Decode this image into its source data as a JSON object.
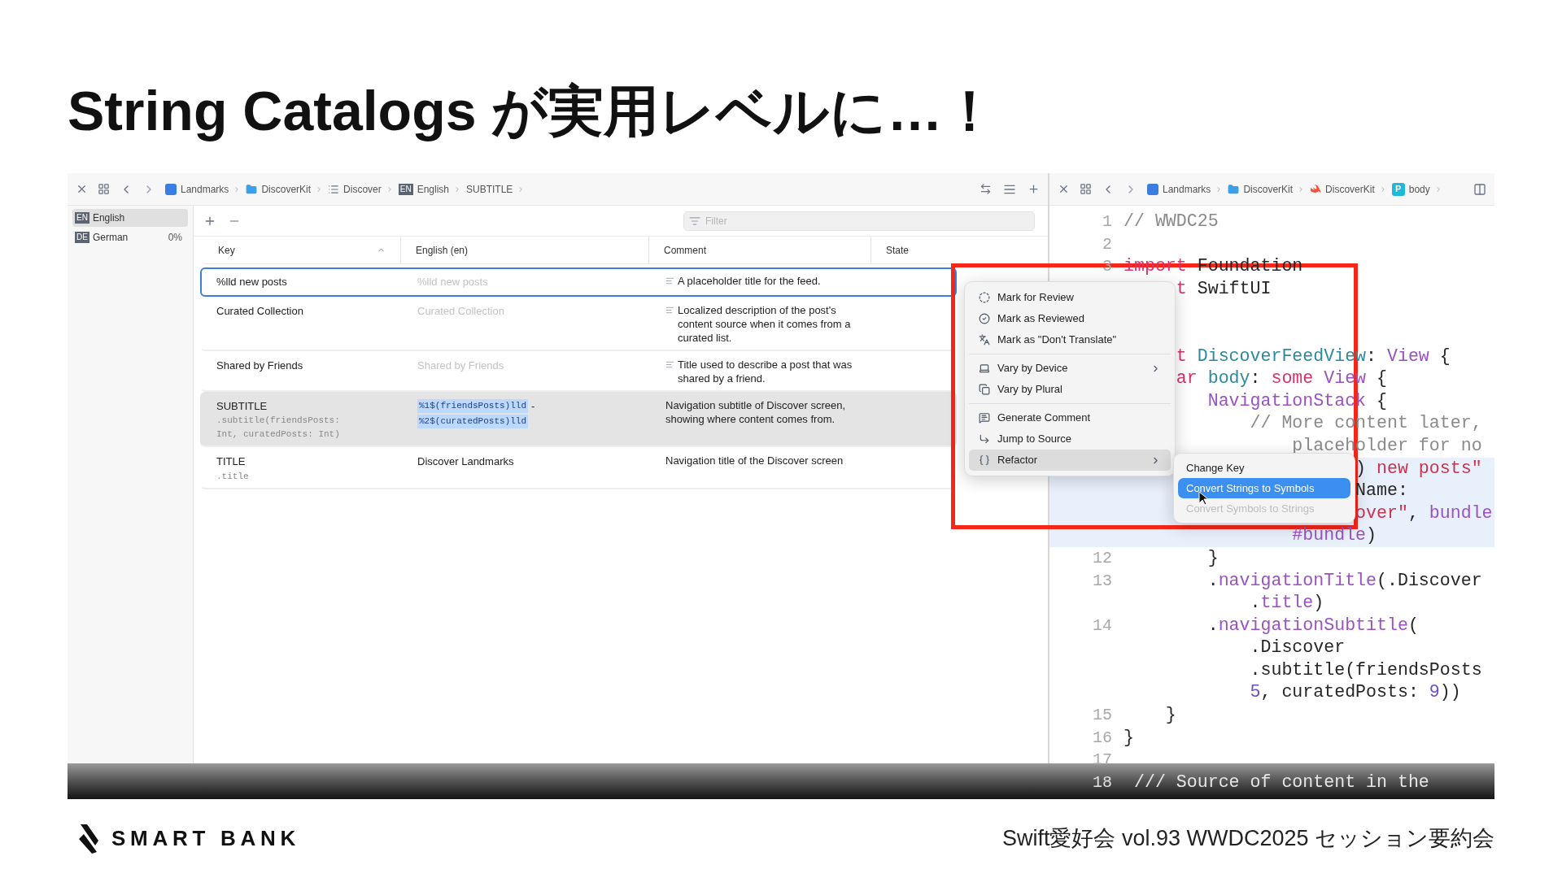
{
  "slide": {
    "title": "String Catalogs が実用レベルに…！"
  },
  "catalog": {
    "breadcrumbs": [
      {
        "kind": "app",
        "label": "Landmarks"
      },
      {
        "kind": "folder",
        "label": "DiscoverKit"
      },
      {
        "kind": "list",
        "label": "Discover"
      },
      {
        "kind": "language",
        "badge": "EN",
        "label": "English"
      },
      {
        "kind": "plain",
        "label": "SUBTITLE"
      }
    ],
    "languages": [
      {
        "badge": "EN",
        "name": "English",
        "selected": true
      },
      {
        "badge": "DE",
        "name": "German",
        "progress": "0%",
        "selected": false
      }
    ],
    "filter": {
      "placeholder": "Filter"
    },
    "columns": [
      {
        "label": "Key",
        "sorted": true
      },
      {
        "label": "English (en)",
        "sorted": false
      },
      {
        "label": "Comment",
        "sorted": false
      },
      {
        "label": "State",
        "sorted": false
      }
    ],
    "rows": [
      {
        "key": "%lld new posts",
        "english": [
          [
            {
              "kind": "faded",
              "text": "%lld new posts"
            }
          ]
        ],
        "comment": "A placeholder title for the feed.",
        "generated": true,
        "focused": true,
        "selected": false
      },
      {
        "key": "Curated Collection",
        "english": [
          [
            {
              "kind": "faded",
              "text": "Curated Collection"
            }
          ]
        ],
        "comment": "Localized description of the post's content source when it comes from a curated list.",
        "generated": true,
        "focused": false,
        "selected": false
      },
      {
        "key": "Shared by Friends",
        "english": [
          [
            {
              "kind": "faded",
              "text": "Shared by Friends"
            }
          ]
        ],
        "comment": "Title used to describe a post that was shared by a friend.",
        "generated": true,
        "focused": false,
        "selected": false
      },
      {
        "key": "SUBTITLE",
        "symbol": ".subtitle(friendsPosts: Int, curatedPosts: Int)",
        "english": [
          [
            {
              "kind": "token",
              "text": "%1$(friendsPosts)lld"
            },
            {
              "kind": "plain",
              "text": "-"
            }
          ],
          [
            {
              "kind": "token",
              "text": "%2$(curatedPosts)lld"
            }
          ]
        ],
        "comment": "Navigation subtitle of Discover screen, showing where content comes from.",
        "generated": false,
        "focused": false,
        "selected": true
      },
      {
        "key": "TITLE",
        "symbol": ".title",
        "english": [
          [
            {
              "kind": "plain",
              "text": "Discover Landmarks"
            }
          ]
        ],
        "comment": "Navigation title of the Discover screen",
        "generated": false,
        "focused": false,
        "selected": false
      }
    ]
  },
  "editor": {
    "breadcrumbs": [
      {
        "kind": "app",
        "label": "Landmarks"
      },
      {
        "kind": "folder",
        "label": "DiscoverKit"
      },
      {
        "kind": "swift",
        "label": "DiscoverKit"
      },
      {
        "kind": "property",
        "badge": "P",
        "label": "body"
      }
    ],
    "lines": [
      {
        "number": "1",
        "highlighted": false,
        "segments": [
          {
            "kind": "comment",
            "text": "// WWDC25"
          }
        ]
      },
      {
        "number": "2",
        "highlighted": false
      },
      {
        "number": "3",
        "highlighted": false,
        "segments": [
          {
            "kind": "keyword",
            "text": "import"
          },
          {
            "kind": "plain",
            "text": " Foundation"
          }
        ]
      },
      {
        "highlighted": false,
        "segments": [
          {
            "kind": "keyword",
            "text": "     t"
          },
          {
            "kind": "plain",
            "text": " SwiftUI"
          }
        ]
      },
      {
        "highlighted": false
      },
      {
        "highlighted": false
      },
      {
        "highlighted": false,
        "segments": [
          {
            "kind": "keyword",
            "text": "     t"
          },
          {
            "kind": "declaration",
            "text": " DiscoverFeedView"
          },
          {
            "kind": "plain",
            "text": ": "
          },
          {
            "kind": "type",
            "text": "View"
          },
          {
            "kind": "plain",
            "text": " {"
          }
        ]
      },
      {
        "highlighted": false,
        "segments": [
          {
            "kind": "keyword",
            "text": "     ar"
          },
          {
            "kind": "declaration",
            "text": " body"
          },
          {
            "kind": "plain",
            "text": ": "
          },
          {
            "kind": "keyword",
            "text": "some"
          },
          {
            "kind": "type",
            "text": " View"
          },
          {
            "kind": "plain",
            "text": " {"
          }
        ]
      },
      {
        "highlighted": false,
        "segments": [
          {
            "kind": "type",
            "text": "        NavigationStack"
          },
          {
            "kind": "plain",
            "text": " {"
          }
        ]
      },
      {
        "highlighted": false,
        "segments": [
          {
            "kind": "comment",
            "text": "            // More content later,"
          }
        ]
      },
      {
        "highlighted": false,
        "segments": [
          {
            "kind": "comment",
            "text": "                placeholder for no"
          }
        ]
      },
      {
        "highlighted": true,
        "segments": [
          {
            "kind": "plain",
            "text": "                      )"
          },
          {
            "kind": "string",
            "text": " new posts\""
          }
        ]
      },
      {
        "highlighted": true,
        "segments": [
          {
            "kind": "plain",
            "text": "                      Name:"
          }
        ]
      },
      {
        "highlighted": true,
        "segments": [
          {
            "kind": "string",
            "text": "                      over\""
          },
          {
            "kind": "plain",
            "text": ", "
          },
          {
            "kind": "type",
            "text": "bundle"
          }
        ]
      },
      {
        "highlighted": true,
        "segments": [
          {
            "kind": "type",
            "text": "                #bundle"
          },
          {
            "kind": "plain",
            "text": ")"
          }
        ]
      },
      {
        "number": "12",
        "highlighted": false,
        "segments": [
          {
            "kind": "plain",
            "text": "        }"
          }
        ]
      },
      {
        "number": "13",
        "highlighted": false,
        "segments": [
          {
            "kind": "plain",
            "text": "        ."
          },
          {
            "kind": "type",
            "text": "navigationTitle"
          },
          {
            "kind": "plain",
            "text": "(.Discover"
          }
        ]
      },
      {
        "highlighted": false,
        "segments": [
          {
            "kind": "plain",
            "text": "            ."
          },
          {
            "kind": "type",
            "text": "title"
          },
          {
            "kind": "plain",
            "text": ")"
          }
        ]
      },
      {
        "number": "14",
        "highlighted": false,
        "segments": [
          {
            "kind": "plain",
            "text": "        ."
          },
          {
            "kind": "type",
            "text": "navigationSubtitle"
          },
          {
            "kind": "plain",
            "text": "("
          }
        ]
      },
      {
        "highlighted": false,
        "segments": [
          {
            "kind": "plain",
            "text": "            .Discover"
          }
        ]
      },
      {
        "highlighted": false,
        "segments": [
          {
            "kind": "plain",
            "text": "            .subtitle(friendsPosts"
          }
        ]
      },
      {
        "highlighted": false,
        "segments": [
          {
            "kind": "number",
            "text": "            5"
          },
          {
            "kind": "plain",
            "text": ", curatedPosts: "
          },
          {
            "kind": "number",
            "text": "9"
          },
          {
            "kind": "plain",
            "text": "))"
          }
        ]
      },
      {
        "number": "15",
        "highlighted": false,
        "segments": [
          {
            "kind": "plain",
            "text": "    }"
          }
        ]
      },
      {
        "number": "16",
        "highlighted": false,
        "segments": [
          {
            "kind": "plain",
            "text": "}"
          }
        ]
      },
      {
        "number": "17",
        "highlighted": false
      },
      {
        "number": "18",
        "segments": [
          {
            "kind": "comment",
            "text": " /// Source of content in the"
          }
        ]
      }
    ]
  },
  "context_menu": {
    "groups": [
      [
        {
          "kind": "review",
          "label": "Mark for Review",
          "submenu": false,
          "selected": false
        },
        {
          "kind": "reviewed",
          "label": "Mark as Reviewed",
          "submenu": false,
          "selected": false
        },
        {
          "kind": "translate",
          "label": "Mark as \"Don't Translate\"",
          "submenu": false,
          "selected": false
        }
      ],
      [
        {
          "kind": "device",
          "label": "Vary by Device",
          "submenu": true,
          "selected": false
        },
        {
          "kind": "plural",
          "label": "Vary by Plural",
          "submenu": false,
          "selected": false
        }
      ],
      [
        {
          "kind": "comment",
          "label": "Generate Comment",
          "submenu": false,
          "selected": false
        },
        {
          "kind": "jump",
          "label": "Jump to Source",
          "submenu": false,
          "selected": false
        },
        {
          "kind": "refactor",
          "label": "Refactor",
          "submenu": true,
          "selected": true
        }
      ]
    ]
  },
  "submenu": {
    "items": [
      {
        "label": "Change Key",
        "selected": false,
        "disabled": false
      },
      {
        "label": "Convert Strings to Symbols",
        "selected": true,
        "disabled": false
      },
      {
        "label": "Convert Symbols to Strings",
        "selected": false,
        "disabled": true
      }
    ]
  },
  "footer": {
    "brand": "SMART BANK",
    "event": "Swift愛好会 vol.93 WWDC2025 セッション要約会"
  }
}
